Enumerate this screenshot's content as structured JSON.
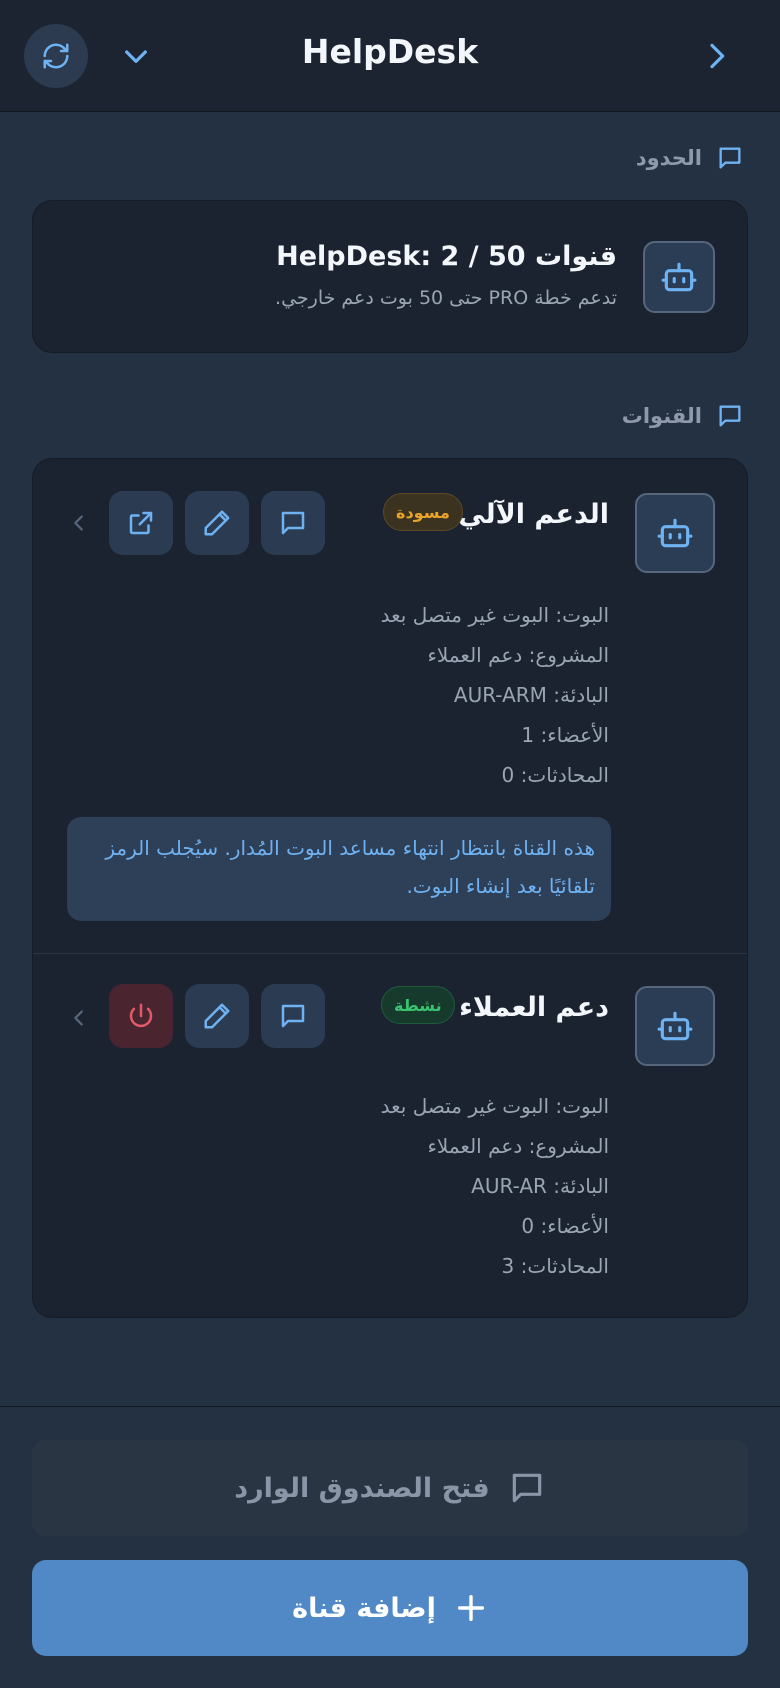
{
  "header": {
    "title": "HelpDesk",
    "refresh_icon": "refresh-icon",
    "dropdown_icon": "chevron-down-icon",
    "forward_icon": "chevron-right-icon"
  },
  "limits_section": {
    "label": "الحدود",
    "title": "قنوات HelpDesk: 2 / 50",
    "subtitle": "تدعم خطة PRO حتى 50 بوت دعم خارجي."
  },
  "channels_section": {
    "label": "القنوات",
    "channels": [
      {
        "name": "الدعم الآلي",
        "status": "مسودة",
        "bot": "البوت: البوت غير متصل بعد",
        "project": "المشروع: دعم العملاء",
        "prefix": "البادئة: AUR-ARM",
        "members": "الأعضاء: 1",
        "conversations": "المحادثات: 0",
        "note": "هذه القناة بانتظار انتهاء مساعد البوت المُدار. سيُجلب الرمز تلقائيًا بعد إنشاء البوت."
      },
      {
        "name": "دعم العملاء",
        "status": "نشطة",
        "bot": "البوت: البوت غير متصل بعد",
        "project": "المشروع: دعم العملاء",
        "prefix": "البادئة: AUR-AR",
        "members": "الأعضاء: 0",
        "conversations": "المحادثات: 3"
      }
    ]
  },
  "footer": {
    "open_inbox": "فتح الصندوق الوارد",
    "add_channel": "إضافة قناة"
  },
  "colors": {
    "accent": "#5189c7",
    "draft": "#e8a32a",
    "active": "#39c370",
    "danger": "#e05a6a"
  }
}
